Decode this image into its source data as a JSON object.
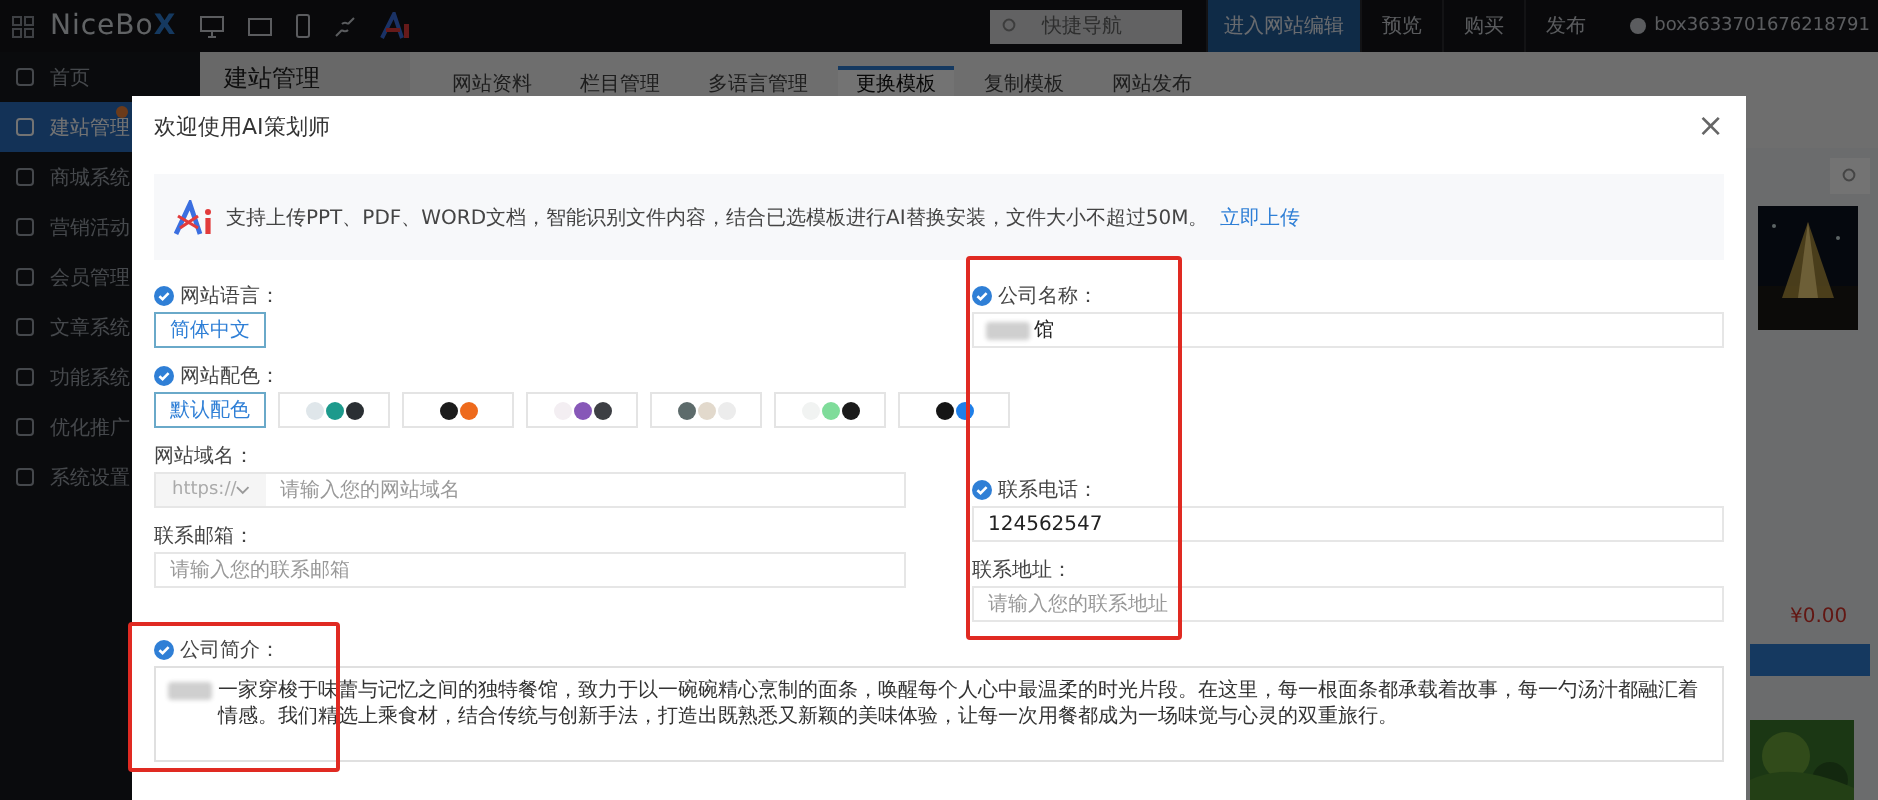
{
  "topbar": {
    "logo": "NiceBoX",
    "search": {
      "placeholder": "快捷导航"
    },
    "actions": [
      {
        "label": "进入网站编辑",
        "primary": true
      },
      {
        "label": "预览",
        "primary": false
      },
      {
        "label": "购买",
        "primary": false
      },
      {
        "label": "发布",
        "primary": false
      }
    ],
    "account": "box3633701676218791"
  },
  "sidebar": {
    "items": [
      {
        "label": "首页",
        "selected": false,
        "badge": false
      },
      {
        "label": "建站管理",
        "selected": true,
        "badge": true
      },
      {
        "label": "商城系统",
        "selected": false,
        "badge": false
      },
      {
        "label": "营销活动",
        "selected": false,
        "badge": false
      },
      {
        "label": "会员管理",
        "selected": false,
        "badge": false
      },
      {
        "label": "文章系统",
        "selected": false,
        "badge": false
      },
      {
        "label": "功能系统",
        "selected": false,
        "badge": false
      },
      {
        "label": "优化推广",
        "selected": false,
        "badge": false
      },
      {
        "label": "系统设置",
        "selected": false,
        "badge": false
      }
    ]
  },
  "page": {
    "title": "建站管理",
    "tabs": [
      {
        "label": "网站资料",
        "selected": false
      },
      {
        "label": "栏目管理",
        "selected": false
      },
      {
        "label": "多语言管理",
        "selected": false
      },
      {
        "label": "更换模板",
        "selected": true
      },
      {
        "label": "复制模板",
        "selected": false
      },
      {
        "label": "网站发布",
        "selected": false
      }
    ],
    "price": "¥0.00"
  },
  "dialog": {
    "title": "欢迎使用AI策划师",
    "close": "×",
    "notice": {
      "text": "支持上传PPT、PDF、WORD文档，智能识别文件内容，结合已选模板进行AI替换安装，文件大小不超过50M。",
      "link": "立即上传"
    },
    "language": {
      "label": "网站语言：",
      "checked": true,
      "value": "简体中文"
    },
    "palette": {
      "label": "网站配色：",
      "checked": true,
      "options": [
        {
          "kind": "text",
          "label": "默认配色",
          "selected": true
        },
        {
          "kind": "dots",
          "dots": [
            {
              "color": "#dfe6ea"
            },
            {
              "color": "#1d9a8c"
            },
            {
              "color": "#2a2f33"
            }
          ],
          "selected": false
        },
        {
          "kind": "dots",
          "dots": [
            {
              "color": "#1c1c1c"
            },
            {
              "color": "#ee6a1c"
            }
          ],
          "selected": false
        },
        {
          "kind": "dots",
          "dots": [
            {
              "color": "#f3eef2"
            },
            {
              "color": "#8758b8"
            },
            {
              "color": "#3d3f44"
            }
          ],
          "selected": false
        },
        {
          "kind": "dots",
          "dots": [
            {
              "color": "#5d6b6b"
            },
            {
              "color": "#e2d9cc"
            },
            {
              "color": "#ececec"
            }
          ],
          "selected": false
        },
        {
          "kind": "dots",
          "dots": [
            {
              "color": "#f1f3f2"
            },
            {
              "color": "#7fdc9a"
            },
            {
              "color": "#1b1b1b"
            }
          ],
          "selected": false
        },
        {
          "kind": "dots",
          "dots": [
            {
              "color": "#151515"
            },
            {
              "color": "#1f7fe8"
            }
          ],
          "selected": false
        }
      ]
    },
    "domain": {
      "label": "网站域名：",
      "checked": false,
      "protocol": "https://",
      "placeholder": "请输入您的网站域名"
    },
    "email": {
      "label": "联系邮箱：",
      "checked": false,
      "placeholder": "请输入您的联系邮箱"
    },
    "company": {
      "label": "公司名称：",
      "checked": true,
      "value": "馆"
    },
    "phone": {
      "label": "联系电话：",
      "checked": true,
      "value": "124562547"
    },
    "address": {
      "label": "联系地址：",
      "checked": false,
      "placeholder": "请输入您的联系地址"
    },
    "intro": {
      "label": "公司简介：",
      "checked": true,
      "value": "一家穿梭于味蕾与记忆之间的独特餐馆，致力于以一碗碗精心烹制的面条，唤醒每个人心中最温柔的时光片段。在这里，每一根面条都承载着故事，每一勺汤汁都融汇着情感。我们精选上乘食材，结合传统与创新手法，打造出既熟悉又新颖的美味体验，让每一次用餐都成为一场味觉与心灵的双重旅行。"
    }
  }
}
